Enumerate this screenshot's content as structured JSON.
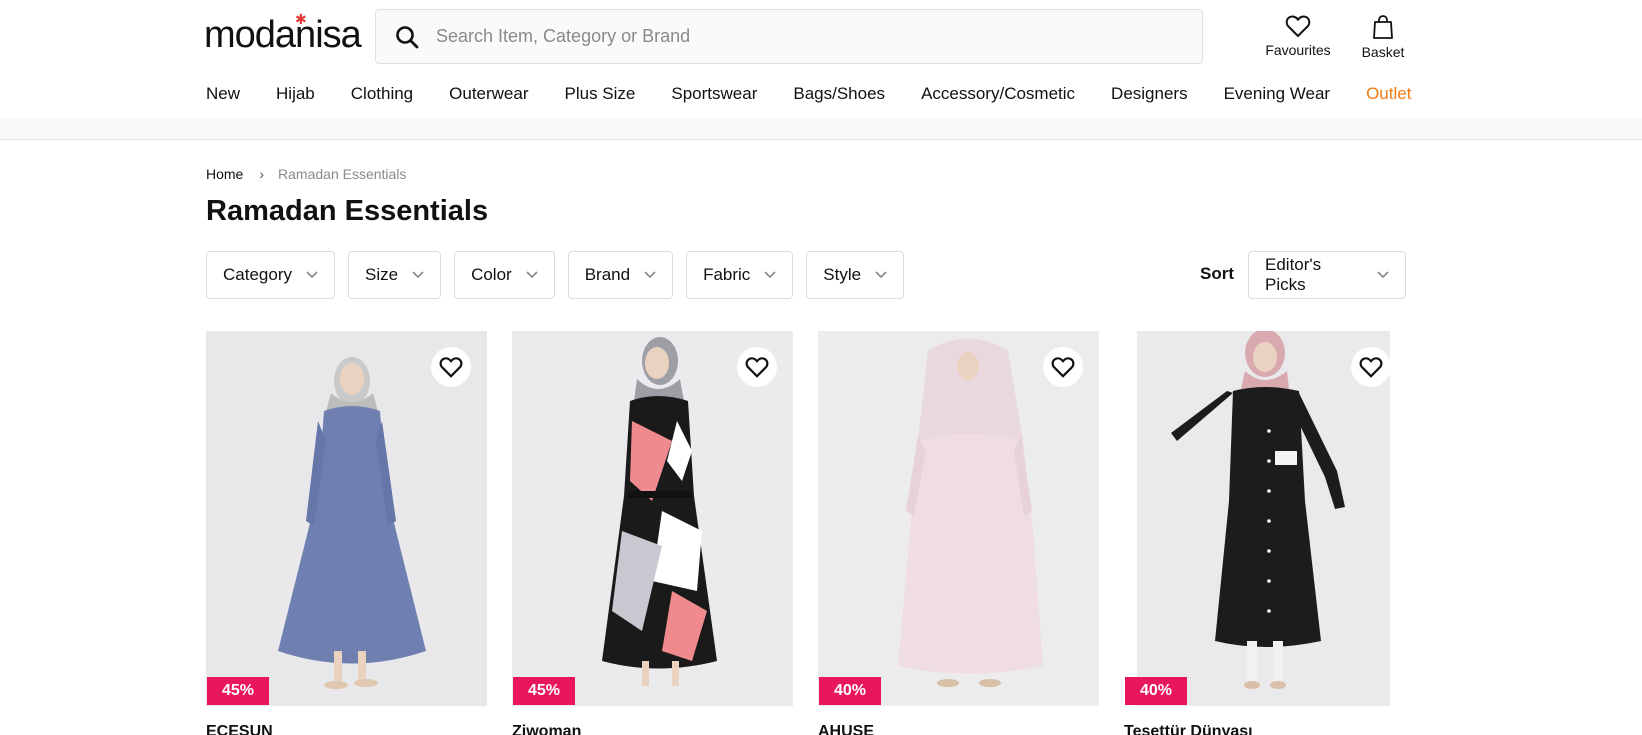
{
  "header": {
    "logo": "modanisa",
    "search": {
      "placeholder": "Search Item, Category or Brand",
      "value": ""
    },
    "favourites_label": "Favourites",
    "basket_label": "Basket"
  },
  "nav": {
    "items": [
      "New",
      "Hijab",
      "Clothing",
      "Outerwear",
      "Plus Size",
      "Sportswear",
      "Bags/Shoes",
      "Accessory/Cosmetic",
      "Designers",
      "Evening Wear",
      "Outlet"
    ]
  },
  "breadcrumb": {
    "home": "Home",
    "separator": "›",
    "current": "Ramadan Essentials"
  },
  "page_title": "Ramadan Essentials",
  "filters": [
    "Category",
    "Size",
    "Color",
    "Brand",
    "Fabric",
    "Style"
  ],
  "sort": {
    "label": "Sort",
    "selected": "Editor's Picks"
  },
  "products": [
    {
      "brand": "ECESUN",
      "discount": "45%"
    },
    {
      "brand": "Ziwoman",
      "discount": "45%"
    },
    {
      "brand": "AHUSE",
      "discount": "40%"
    },
    {
      "brand": "Tesettür Dünyası",
      "discount": "40%"
    }
  ],
  "colors": {
    "accent_outlet": "#f07a12",
    "discount_badge": "#e8175d",
    "logo_star": "#e53935"
  }
}
